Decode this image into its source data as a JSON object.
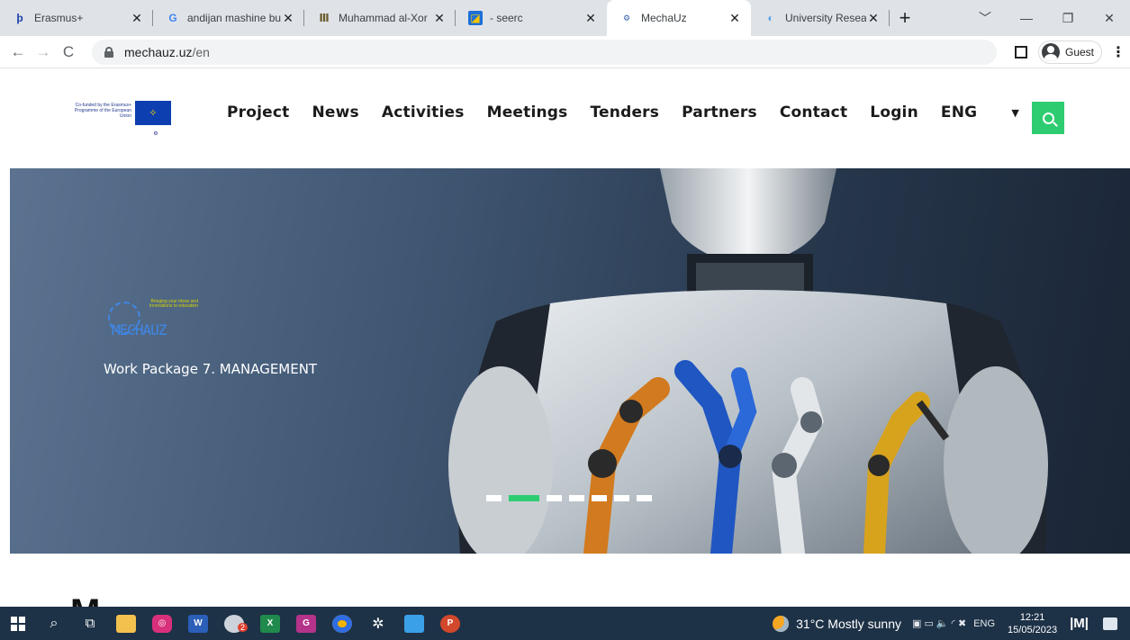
{
  "browser": {
    "tabs": [
      {
        "title": "Erasmus+",
        "favicon": "erasmus-icon",
        "active": false
      },
      {
        "title": "andijan mashine bu",
        "favicon": "google-icon",
        "active": false
      },
      {
        "title": "Muhammad al-Xor",
        "favicon": "museum-icon",
        "active": false
      },
      {
        "title": "- seerc",
        "favicon": "seerc-icon",
        "active": false
      },
      {
        "title": "MechaUz",
        "favicon": "mechauz-icon",
        "active": true
      },
      {
        "title": "University Research",
        "favicon": "university-icon",
        "active": false
      }
    ],
    "new_tab": "+",
    "url_host": "mechauz.uz",
    "url_path": "/en",
    "profile_label": "Guest"
  },
  "site": {
    "eu_text": "Co-funded by the Erasmus+ Programme of the European Union",
    "nav": [
      "Project",
      "News",
      "Activities",
      "Meetings",
      "Tenders",
      "Partners",
      "Contact",
      "Login",
      "ENG"
    ],
    "accent": "#2ecc71"
  },
  "hero": {
    "logo_word": "MECHAUZ",
    "logo_tagline": "Bringing your ideas and innovations to education",
    "slide_title": "Work Package 7. MANAGEMENT",
    "slides_total": 8,
    "active_slide": 2
  },
  "taskbar": {
    "weather": "31°C  Mostly sunny",
    "lang": "ENG",
    "time": "12:21",
    "date": "15/05/2023",
    "badge": "2"
  }
}
